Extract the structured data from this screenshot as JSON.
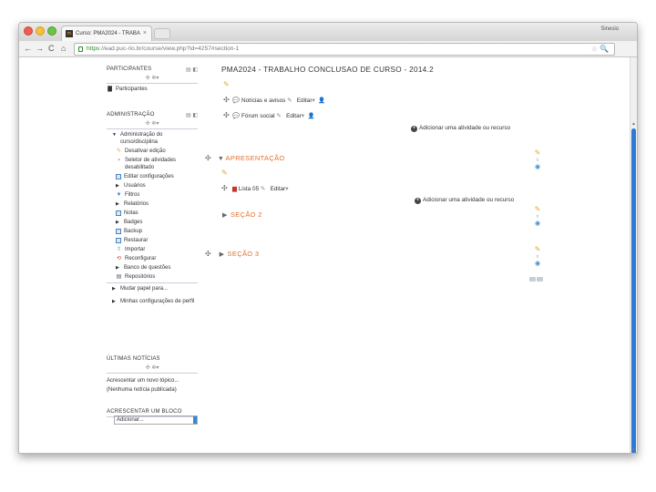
{
  "browser": {
    "tab_title": "Curso: PMA2024 - TRABA",
    "tab_close": "×",
    "favicon": "m",
    "profile": "Sinesio",
    "url_scheme": "https",
    "url_rest": "://ead.puc-rio.br/course/view.php?id=4257#section-1",
    "back": "←",
    "forward": "→",
    "reload": "C",
    "home": "⌂",
    "star": "☆",
    "search": "🔍",
    "menu": "≡"
  },
  "sidebar": {
    "participantes": {
      "title": "PARTICIPANTES",
      "items": [
        {
          "label": "Participantes"
        }
      ]
    },
    "administracao": {
      "title": "ADMINISTRAÇÃO",
      "items": [
        {
          "label": "Administração do curso/disciplina"
        },
        {
          "label": "Desativar edição"
        },
        {
          "label": "Seletor de atividades desabilitado"
        },
        {
          "label": "Editar configurações"
        },
        {
          "label": "Usuários"
        },
        {
          "label": "Filtros"
        },
        {
          "label": "Relatórios"
        },
        {
          "label": "Notas"
        },
        {
          "label": "Badges"
        },
        {
          "label": "Backup"
        },
        {
          "label": "Restaurar"
        },
        {
          "label": "Importar"
        },
        {
          "label": "Reconfigurar"
        },
        {
          "label": "Banco de questões"
        },
        {
          "label": "Repositórios"
        },
        {
          "label": "Mudar papel para..."
        },
        {
          "label": "Minhas configurações de perfil"
        }
      ]
    },
    "noticias": {
      "title": "ÚLTIMAS NOTÍCIAS",
      "add_topic": "Acrescentar um novo tópico...",
      "empty": "(Nenhuma notícia publicada)"
    },
    "blog": {
      "title": "ACRESCENTAR UM BLOCO",
      "select_value": "Adicionar..."
    }
  },
  "main": {
    "course_title": "PMA2024 - TRABALHO CONCLUSAO DE CURSO - 2014.2",
    "top_activities": [
      {
        "label": "Notícias e avisos",
        "edit": "Editar"
      },
      {
        "label": "Fórum social",
        "edit": "Editar"
      }
    ],
    "add_activity": "Adicionar uma atividade ou recurso",
    "sections": [
      {
        "name": "APRESENTAÇÃO",
        "activity": "Lista 05",
        "edit": "Editar",
        "add": "Adicionar uma atividade ou recurso"
      },
      {
        "name": "SEÇÃO 2"
      },
      {
        "name": "SEÇÃO 3"
      }
    ]
  }
}
